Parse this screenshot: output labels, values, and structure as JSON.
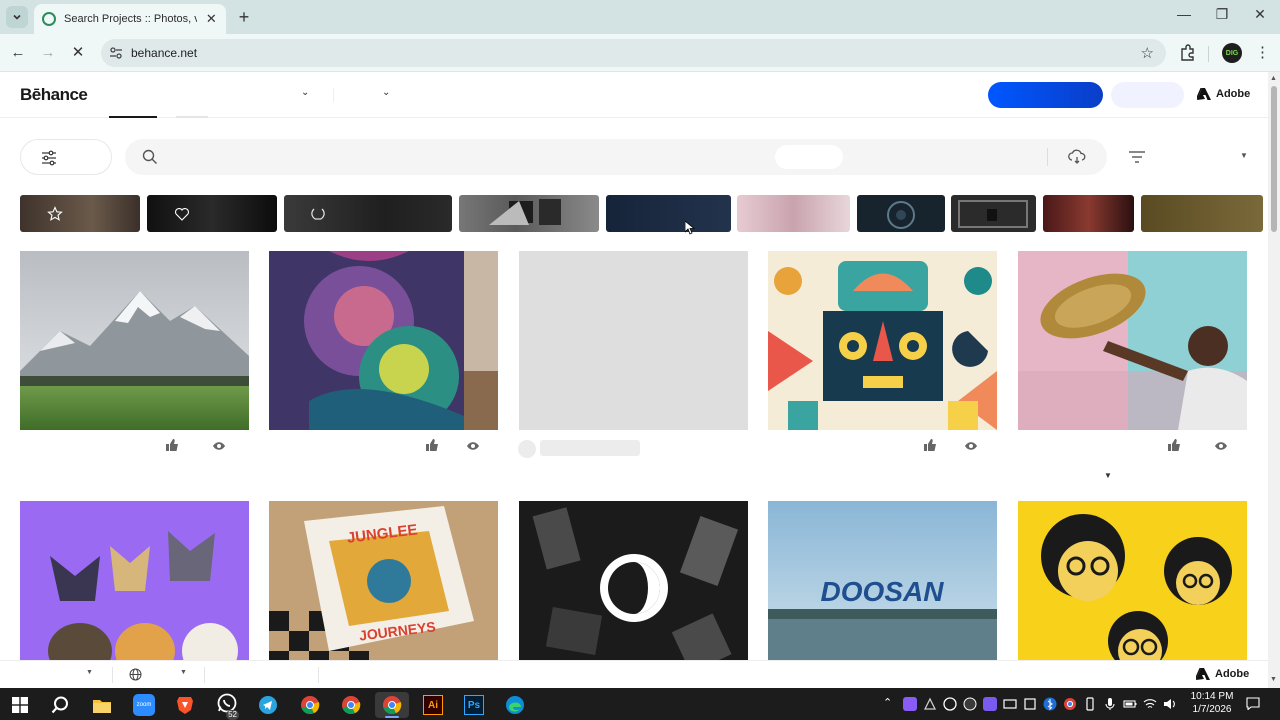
{
  "browser": {
    "tab_title": "Search Projects :: Photos, videos, logos, illustrations and branding",
    "url": "behance.net",
    "profile_initials": "DIG",
    "window_controls": [
      "minimize",
      "maximize",
      "close"
    ]
  },
  "header": {
    "logo": "Bēhance",
    "adobe_label": "Adobe"
  },
  "categories": [
    {
      "icon": "star-icon",
      "color": "#4a3c33"
    },
    {
      "icon": "heart-icon",
      "color": "#111111"
    },
    {
      "icon": "laurel-icon",
      "color": "#2a2a2a"
    },
    {
      "icon": "",
      "color": "#6a6a6a"
    },
    {
      "icon": "",
      "color": "#1b2b3f"
    },
    {
      "icon": "",
      "color": "#d6b6c0"
    },
    {
      "icon": "",
      "color": "#1a2a35"
    },
    {
      "icon": "",
      "color": "#333333"
    },
    {
      "icon": "",
      "color": "#6b2020"
    },
    {
      "icon": "",
      "color": "#6b5a2a"
    }
  ],
  "projects": [
    {
      "subject": "snowy mountain landscape",
      "has_stats": true
    },
    {
      "subject": "lion mural",
      "has_stats": true
    },
    {
      "subject": "loading placeholder",
      "has_stats": false
    },
    {
      "subject": "geometric mask illustration",
      "has_stats": true
    },
    {
      "subject": "man with tambourine",
      "has_stats": true
    },
    {
      "subject": "cartoon cats",
      "has_stats": false
    },
    {
      "subject": "Junglee Journeys box",
      "has_stats": false
    },
    {
      "subject": "dark industrial shapes",
      "has_stats": false
    },
    {
      "subject": "Doosan brand",
      "has_stats": false
    },
    {
      "subject": "faces illustration",
      "has_stats": false
    }
  ],
  "card_text": {
    "jungle_top": "JUNGLEE",
    "jungle_bottom": "JOURNEYS",
    "doosan": "DOOSAN"
  },
  "footer": {
    "adobe_label": "Adobe"
  },
  "taskbar": {
    "apps": [
      "start",
      "search",
      "file-explorer",
      "zoom",
      "brave",
      "whatsapp",
      "telegram",
      "chrome",
      "chrome",
      "chrome",
      "illustrator",
      "photoshop",
      "edge"
    ],
    "whatsapp_badge": "52",
    "zoom_label": "zoom",
    "ai_label": "Ai",
    "ps_label": "Ps",
    "time": "10:14 PM",
    "date": "1/7/2026"
  }
}
